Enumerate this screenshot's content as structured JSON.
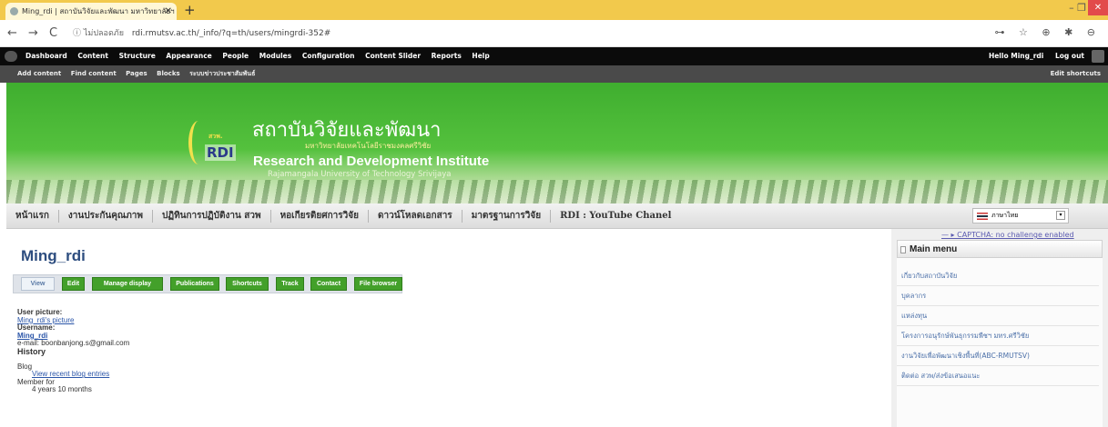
{
  "browser": {
    "tab_title": "Ming_rdi | สถาบันวิจัยและพัฒนา มหาวิทยาลัยฯ",
    "tab_close": "✕",
    "new_tab": "+",
    "window_controls": "–  ❐",
    "window_close": "✕",
    "nav_back": "←",
    "nav_forward": "→",
    "nav_reload": "C",
    "secure_label": "ⓘ ไม่ปลอดภัย",
    "url": "rdi.rmutsv.ac.th/_info/?q=th/users/mingrdi-352#",
    "toolbar_icons": "⊶ ☆ ⊕ ✱ ⊖"
  },
  "admin_toolbar": {
    "menu": [
      "Dashboard",
      "Content",
      "Structure",
      "Appearance",
      "People",
      "Modules",
      "Configuration",
      "Content Slider",
      "Reports",
      "Help"
    ],
    "hello": "Hello",
    "username": "Ming_rdi",
    "logout": "Log out"
  },
  "shortcuts": {
    "items": [
      "Add content",
      "Find content",
      "Pages",
      "Blocks",
      "ระบบข่าวประชาสัมพันธ์"
    ],
    "edit": "Edit shortcuts"
  },
  "banner": {
    "logo_top": "สวพ.",
    "logo_text": "RDI",
    "title_th": "สถาบันวิจัยและพัฒนา",
    "subtitle_th": "มหาวิทยาลัยเทคโนโลยีราชมงคลศรีวิชัย",
    "title_en": "Research and Development Institute",
    "subtitle_en": "Rajamangala University of Technology Srivijaya"
  },
  "main_nav": {
    "items": [
      "หน้าแรก",
      "งานประกันคุณภาพ",
      "ปฏิทินการปฏิบัติงาน สวพ",
      "หอเกียรติยศการวิจัย",
      "ดาวน์โหลดเอกสาร",
      "มาตรฐานการวิจัย",
      "RDI : YouTube Chanel"
    ],
    "language": "ภาษาไทย",
    "language_dd": "▾"
  },
  "page": {
    "title": "Ming_rdi",
    "tabs": [
      "View",
      "Edit",
      "Manage display",
      "Publications",
      "Shortcuts",
      "Track",
      "Contact",
      "File browser"
    ]
  },
  "profile": {
    "picture_label": "User picture:",
    "picture_alt": "Ming_rdi's picture",
    "username_label": "Username:",
    "username": "Ming_rdi",
    "email": "e-mail: boonbanjong.s@gmail.com",
    "history_label": "History",
    "blog_label": "Blog",
    "blog_link": "View recent blog entries",
    "member_label": "Member for",
    "member_value": "4 years 10 months"
  },
  "sidebar": {
    "captcha": "— ▸ CAPTCHA: no challenge enabled",
    "menu_title": "Main menu",
    "items": [
      "เกี่ยวกับสถาบันวิจัย",
      "บุคลากร",
      "แหล่งทุน",
      "โครงการอนุรักษ์พันธุกรรมพืชฯ มทร.ศรีวิชัย",
      "งานวิจัยเพื่อพัฒนาเชิงพื้นที่(ABC-RMUTSV)",
      "ติดต่อ สวพ/ส่งข้อเสนอแนะ"
    ]
  },
  "colors": {
    "admin_bar": "#0b0b0b",
    "shortcut_bar": "#4a4a4a",
    "banner_green": "#54c13d",
    "tab_green": "#43a02a",
    "title_blue": "#2d4d7f",
    "link_blue": "#2a55a8"
  }
}
